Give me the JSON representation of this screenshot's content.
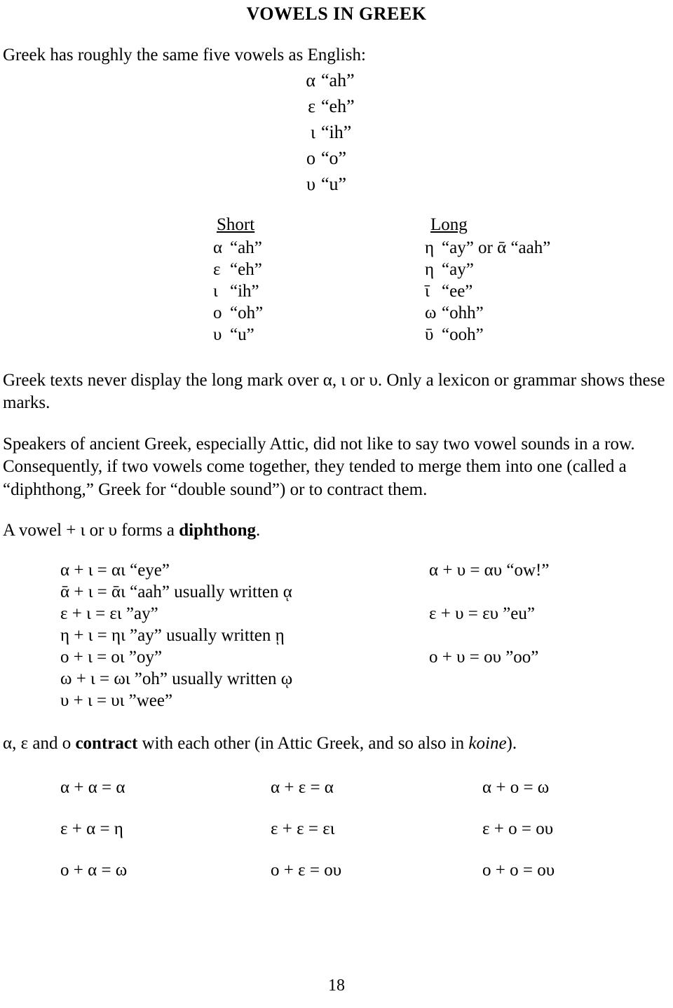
{
  "document": {
    "title": "VOWELS IN GREEK",
    "page_number": "18"
  },
  "intro": {
    "line": "Greek has roughly the same five vowels as English:",
    "vowels": [
      {
        "letter": "α",
        "sound": "“ah”"
      },
      {
        "letter": "ε",
        "sound": "“eh”"
      },
      {
        "letter": "ι",
        "sound": "“ih”"
      },
      {
        "letter": "ο",
        "sound": "“o”"
      },
      {
        "letter": "υ",
        "sound": "“u”"
      }
    ]
  },
  "length_table": {
    "headers": {
      "short": "Short",
      "long": "Long"
    },
    "rows": [
      {
        "short_sym": "α",
        "short_val": "“ah”",
        "long_sym": "η",
        "long_val": "“ay” or ᾱ “aah”"
      },
      {
        "short_sym": "ε",
        "short_val": "“eh”",
        "long_sym": "η",
        "long_val": "“ay”"
      },
      {
        "short_sym": "ι",
        "short_val": "“ih”",
        "long_sym": "ῑ",
        "long_val": "“ee”"
      },
      {
        "short_sym": "ο",
        "short_val": "“oh”",
        "long_sym": "ω",
        "long_val": "“ohh”"
      },
      {
        "short_sym": "υ",
        "short_val": "“u”",
        "long_sym": "ῡ",
        "long_val": "“ooh”"
      }
    ]
  },
  "paragraphs": {
    "long_mark": "Greek texts never display the long mark over α, ι or υ.  Only a lexicon or grammar shows these marks.",
    "merge_pre": "Speakers of ancient Greek, especially Attic, did not like to say two vowel sounds in a row. Consequently, if two vowels come together, they tended to merge them into one (called a “diphthong,” Greek for “double sound”) or to contract them.",
    "diphthong_rule_pre": "A vowel + ι or υ forms a ",
    "diphthong_rule_bold": "diphthong",
    "diphthong_rule_post": "."
  },
  "diphthongs": {
    "iota_rows": [
      "α + ι  = αι “eye”",
      "ᾱ + ι = ᾱι “aah” usually written ᾳ",
      "ε + ι  = ει ”ay”",
      "η + ι  = ηι ”ay” usually written ῃ",
      "ο + ι  = οι ”oy”",
      "ω + ι = ωι ”oh” usually written ῳ",
      "υ + ι  = υι ”wee”"
    ],
    "upsilon_rows": [
      {
        "row_index": 0,
        "text": "α + υ = αυ “ow!”"
      },
      {
        "row_index": 2,
        "text": "ε + υ = ευ ”eu”"
      },
      {
        "row_index": 4,
        "text": "ο + υ = ου ”oo”"
      }
    ]
  },
  "contraction": {
    "note_pre": "α, ε and ο ",
    "note_bold": "contract",
    "note_mid": " with each other (in Attic Greek, and so also in ",
    "note_italic": "koine",
    "note_post": ").",
    "rows": [
      {
        "c1": "α + α = α",
        "c2": "α + ε = α",
        "c3": "α + ο = ω"
      },
      {
        "c1": "ε + α = η",
        "c2": "ε + ε = ει",
        "c3": "ε + ο = ου"
      },
      {
        "c1": "ο + α = ω",
        "c2": "ο + ε = ου",
        "c3": "ο + ο = ου"
      }
    ]
  }
}
